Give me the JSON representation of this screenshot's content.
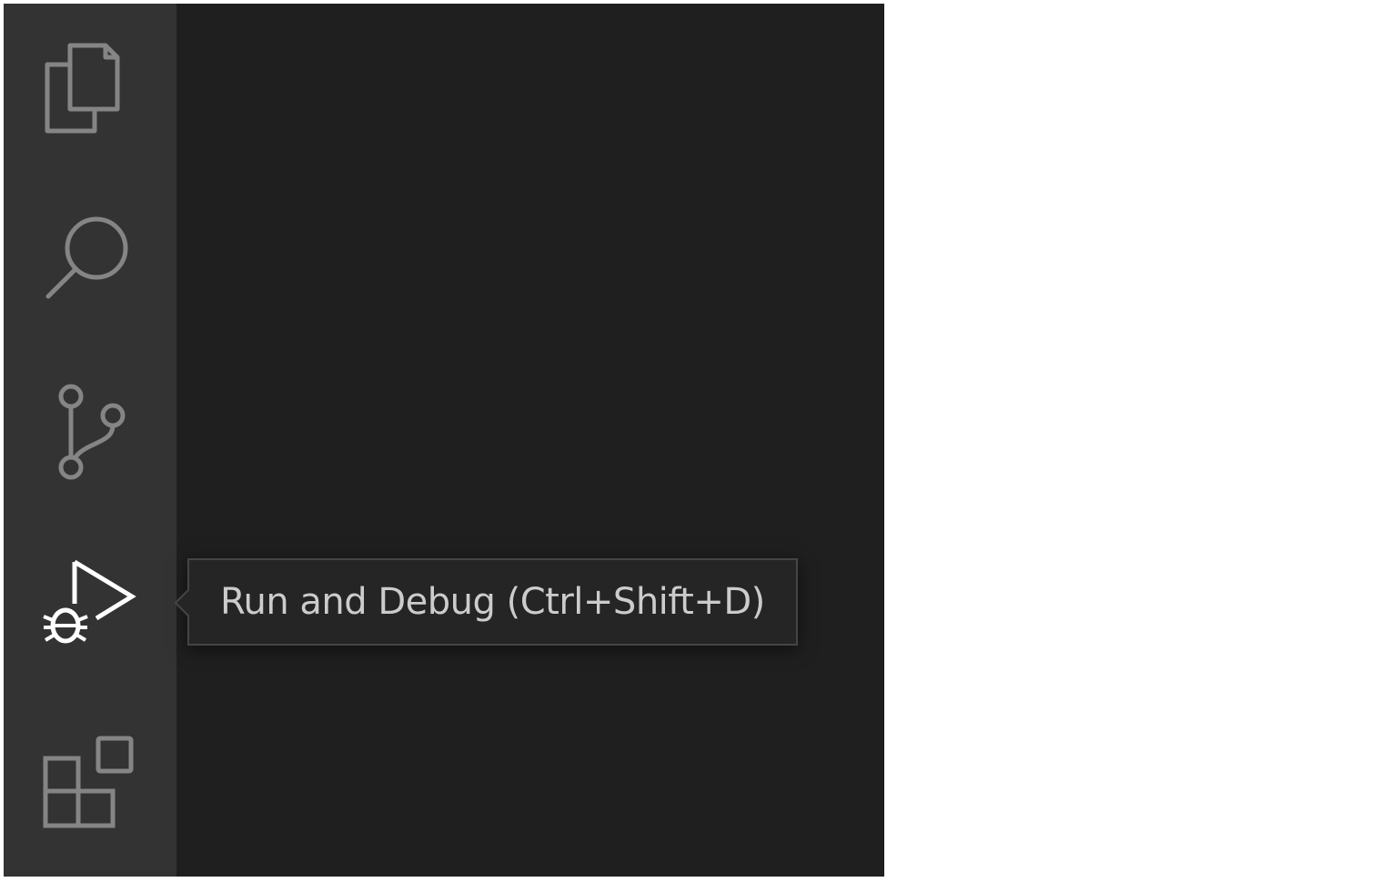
{
  "activity_bar": {
    "items": [
      {
        "id": "explorer",
        "icon": "files-icon",
        "active": false
      },
      {
        "id": "search",
        "icon": "search-icon",
        "active": false
      },
      {
        "id": "source-control",
        "icon": "source-control-icon",
        "active": false
      },
      {
        "id": "run-and-debug",
        "icon": "run-debug-icon",
        "active": true
      },
      {
        "id": "extensions",
        "icon": "extensions-icon",
        "active": false
      }
    ]
  },
  "tooltip": {
    "text": "Run and Debug (Ctrl+Shift+D)"
  },
  "colors": {
    "activity_bar_bg": "#333333",
    "editor_bg": "#1f1f1f",
    "icon_inactive": "#858585",
    "icon_active": "#ffffff",
    "tooltip_bg": "#252526",
    "tooltip_border": "#454545",
    "tooltip_text": "#cccccc"
  }
}
